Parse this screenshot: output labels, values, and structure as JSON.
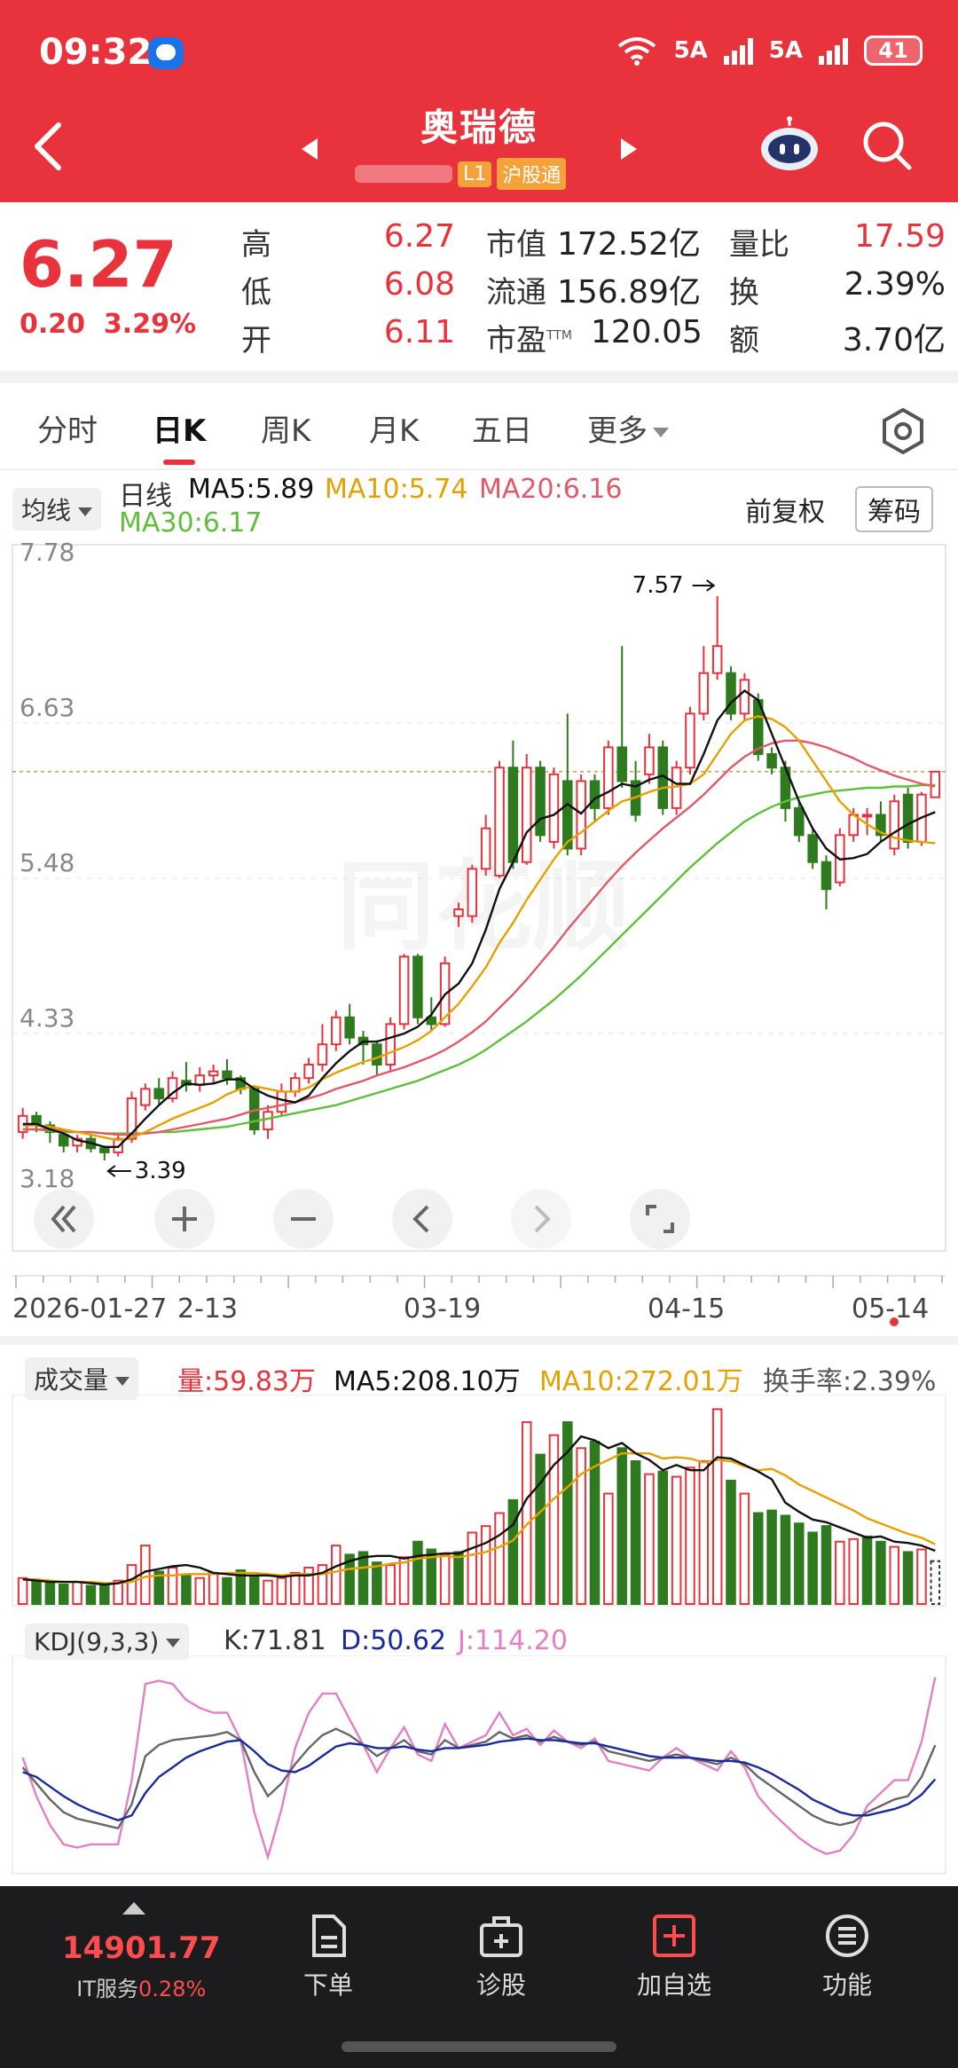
{
  "status": {
    "time": "09:32",
    "net1": "5A",
    "net2": "5A",
    "battery": "41"
  },
  "header": {
    "stock_name": "奥瑞德",
    "tag_l1": "L1",
    "tag_hgt": "沪股通"
  },
  "quote": {
    "price": "6.27",
    "change": "0.20",
    "change_pct": "3.29%",
    "high_lbl": "高",
    "high": "6.27",
    "low_lbl": "低",
    "low": "6.08",
    "open_lbl": "开",
    "open": "6.11",
    "mktcap_lbl": "市值",
    "mktcap": "172.52亿",
    "float_lbl": "流通",
    "float": "156.89亿",
    "pe_lbl": "市盈",
    "pe_sup": "TTM",
    "pe": "120.05",
    "volratio_lbl": "量比",
    "volratio": "17.59",
    "turnover_lbl": "换",
    "turnover": "2.39%",
    "amount_lbl": "额",
    "amount": "3.70亿"
  },
  "tabs": [
    "分时",
    "日K",
    "周K",
    "月K",
    "五日",
    "更多"
  ],
  "ma": {
    "dropdown": "均线",
    "period": "日线",
    "ma5": "MA5:5.89",
    "ma10": "MA10:5.74",
    "ma20": "MA20:6.16",
    "ma30": "MA30:6.17",
    "fq": "前复权",
    "chip": "筹码",
    "colors": {
      "ma5": "#111111",
      "ma10": "#e6a100",
      "ma20": "#e05a6a",
      "ma30": "#5fbf3a"
    }
  },
  "chart_data": [
    {
      "type": "candlestick",
      "title": "",
      "y_ticks": [
        "7.78",
        "6.63",
        "5.48",
        "4.33",
        "3.18"
      ],
      "ylim": [
        3.18,
        7.78
      ],
      "x_ticks": [
        "2026-01-27",
        "2-13",
        "03-19",
        "04-15",
        "05-14"
      ],
      "annotations": {
        "high": "7.57",
        "low": "3.39"
      },
      "current_price": 6.27,
      "candles": [
        [
          3.6,
          3.72,
          3.55,
          3.78
        ],
        [
          3.72,
          3.65,
          3.6,
          3.75
        ],
        [
          3.65,
          3.6,
          3.52,
          3.68
        ],
        [
          3.58,
          3.5,
          3.45,
          3.6
        ],
        [
          3.5,
          3.55,
          3.45,
          3.58
        ],
        [
          3.55,
          3.48,
          3.45,
          3.58
        ],
        [
          3.48,
          3.45,
          3.39,
          3.5
        ],
        [
          3.45,
          3.55,
          3.42,
          3.58
        ],
        [
          3.55,
          3.85,
          3.52,
          3.9
        ],
        [
          3.8,
          3.92,
          3.76,
          3.96
        ],
        [
          3.92,
          3.85,
          3.8,
          4.0
        ],
        [
          3.85,
          4.0,
          3.82,
          4.05
        ],
        [
          3.98,
          3.95,
          3.9,
          4.12
        ],
        [
          3.95,
          4.02,
          3.9,
          4.08
        ],
        [
          4.02,
          4.05,
          3.96,
          4.1
        ],
        [
          4.05,
          4.0,
          3.95,
          4.14
        ],
        [
          4.0,
          3.92,
          3.88,
          4.02
        ],
        [
          3.92,
          3.62,
          3.58,
          3.94
        ],
        [
          3.62,
          3.75,
          3.55,
          3.8
        ],
        [
          3.75,
          3.9,
          3.72,
          3.96
        ],
        [
          3.9,
          4.0,
          3.86,
          4.04
        ],
        [
          4.0,
          4.1,
          3.96,
          4.15
        ],
        [
          4.1,
          4.25,
          4.05,
          4.4
        ],
        [
          4.25,
          4.45,
          4.2,
          4.5
        ],
        [
          4.45,
          4.3,
          4.25,
          4.55
        ],
        [
          4.3,
          4.25,
          4.1,
          4.35
        ],
        [
          4.25,
          4.1,
          4.02,
          4.28
        ],
        [
          4.1,
          4.4,
          4.05,
          4.45
        ],
        [
          4.4,
          4.9,
          4.36,
          4.92
        ],
        [
          4.9,
          4.45,
          4.4,
          4.92
        ],
        [
          4.45,
          4.4,
          4.35,
          4.6
        ],
        [
          4.4,
          4.85,
          4.38,
          4.9
        ],
        [
          5.2,
          5.25,
          5.12,
          5.3
        ],
        [
          5.2,
          5.55,
          5.15,
          5.58
        ],
        [
          5.55,
          5.85,
          5.5,
          5.95
        ],
        [
          5.5,
          6.3,
          5.48,
          6.35
        ],
        [
          6.3,
          5.6,
          5.55,
          6.5
        ],
        [
          5.6,
          6.3,
          5.58,
          6.4
        ],
        [
          6.3,
          5.8,
          5.75,
          6.35
        ],
        [
          5.75,
          6.25,
          5.7,
          6.3
        ],
        [
          6.2,
          5.7,
          5.65,
          6.7
        ],
        [
          5.7,
          6.2,
          5.65,
          6.25
        ],
        [
          6.2,
          6.0,
          5.9,
          6.25
        ],
        [
          6.0,
          6.45,
          5.95,
          6.5
        ],
        [
          6.45,
          6.2,
          6.15,
          7.2
        ],
        [
          6.2,
          5.95,
          5.9,
          6.35
        ],
        [
          6.25,
          6.45,
          6.18,
          6.55
        ],
        [
          6.45,
          6.0,
          5.95,
          6.5
        ],
        [
          6.0,
          6.3,
          5.95,
          6.35
        ],
        [
          6.3,
          6.7,
          6.25,
          6.75
        ],
        [
          6.7,
          7.0,
          6.65,
          7.2
        ],
        [
          7.0,
          7.2,
          6.95,
          7.57
        ],
        [
          7.0,
          6.7,
          6.65,
          7.05
        ],
        [
          6.7,
          6.95,
          6.65,
          7.0
        ],
        [
          6.8,
          6.4,
          6.35,
          6.85
        ],
        [
          6.4,
          6.3,
          6.25,
          6.45
        ],
        [
          6.3,
          6.0,
          5.9,
          6.35
        ],
        [
          6.0,
          5.8,
          5.75,
          6.05
        ],
        [
          5.8,
          5.6,
          5.55,
          5.85
        ],
        [
          5.6,
          5.4,
          5.25,
          5.65
        ],
        [
          5.45,
          5.8,
          5.42,
          5.85
        ],
        [
          5.8,
          5.95,
          5.75,
          6.0
        ],
        [
          5.95,
          5.95,
          5.8,
          6.0
        ],
        [
          5.95,
          5.8,
          5.75,
          6.05
        ],
        [
          5.7,
          6.05,
          5.65,
          6.1
        ],
        [
          6.1,
          5.75,
          5.7,
          6.15
        ],
        [
          5.75,
          6.1,
          5.72,
          6.12
        ],
        [
          6.08,
          6.27,
          6.08,
          6.27
        ]
      ],
      "ma5": [
        3.66,
        3.66,
        3.62,
        3.59,
        3.54,
        3.52,
        3.49,
        3.49,
        3.59,
        3.7,
        3.8,
        3.89,
        3.96,
        3.95,
        3.96,
        3.99,
        3.99,
        3.92,
        3.87,
        3.84,
        3.82,
        3.87,
        4.0,
        4.11,
        4.2,
        4.27,
        4.27,
        4.3,
        4.33,
        4.38,
        4.47,
        4.62,
        4.7,
        4.85,
        5.1,
        5.4,
        5.6,
        5.82,
        5.92,
        5.95,
        6.03,
        5.96,
        6.07,
        6.12,
        6.18,
        6.16,
        6.21,
        6.24,
        6.18,
        6.18,
        6.4,
        6.65,
        6.78,
        6.87,
        6.8,
        6.55,
        6.3,
        6.05,
        5.85,
        5.7,
        5.62,
        5.63,
        5.66,
        5.75,
        5.82,
        5.88,
        5.93,
        5.97
      ],
      "ma10": [
        3.65,
        3.65,
        3.64,
        3.62,
        3.6,
        3.58,
        3.56,
        3.54,
        3.56,
        3.6,
        3.65,
        3.7,
        3.74,
        3.78,
        3.82,
        3.88,
        3.92,
        3.94,
        3.92,
        3.9,
        3.9,
        3.93,
        3.99,
        4.04,
        4.08,
        4.12,
        4.15,
        4.19,
        4.23,
        4.28,
        4.35,
        4.45,
        4.55,
        4.68,
        4.82,
        5.0,
        5.15,
        5.32,
        5.47,
        5.62,
        5.75,
        5.82,
        5.9,
        5.98,
        6.05,
        6.08,
        6.12,
        6.15,
        6.16,
        6.18,
        6.25,
        6.4,
        6.55,
        6.65,
        6.68,
        6.66,
        6.6,
        6.5,
        6.35,
        6.2,
        6.05,
        5.95,
        5.88,
        5.82,
        5.78,
        5.76,
        5.75,
        5.74
      ],
      "ma20": [
        3.62,
        3.62,
        3.62,
        3.61,
        3.6,
        3.6,
        3.59,
        3.58,
        3.58,
        3.59,
        3.6,
        3.62,
        3.64,
        3.66,
        3.68,
        3.7,
        3.73,
        3.76,
        3.78,
        3.8,
        3.82,
        3.85,
        3.88,
        3.92,
        3.95,
        3.98,
        4.02,
        4.05,
        4.08,
        4.12,
        4.16,
        4.21,
        4.27,
        4.34,
        4.42,
        4.52,
        4.62,
        4.73,
        4.85,
        4.97,
        5.1,
        5.22,
        5.34,
        5.46,
        5.57,
        5.67,
        5.76,
        5.85,
        5.93,
        6.01,
        6.1,
        6.2,
        6.3,
        6.38,
        6.44,
        6.48,
        6.5,
        6.5,
        6.48,
        6.45,
        6.41,
        6.37,
        6.32,
        6.28,
        6.24,
        6.21,
        6.18,
        6.16
      ],
      "ma30": [
        3.62,
        3.62,
        3.61,
        3.6,
        3.6,
        3.6,
        3.59,
        3.59,
        3.59,
        3.59,
        3.6,
        3.6,
        3.61,
        3.62,
        3.63,
        3.64,
        3.66,
        3.68,
        3.7,
        3.72,
        3.74,
        3.76,
        3.78,
        3.8,
        3.83,
        3.86,
        3.89,
        3.92,
        3.95,
        3.98,
        4.02,
        4.06,
        4.1,
        4.15,
        4.21,
        4.28,
        4.35,
        4.42,
        4.5,
        4.58,
        4.67,
        4.76,
        4.86,
        4.96,
        5.06,
        5.16,
        5.26,
        5.36,
        5.46,
        5.56,
        5.65,
        5.74,
        5.82,
        5.9,
        5.96,
        6.01,
        6.05,
        6.08,
        6.1,
        6.12,
        6.13,
        6.14,
        6.15,
        6.15,
        6.16,
        6.16,
        6.17,
        6.17
      ]
    },
    {
      "type": "bar",
      "title": "成交量",
      "dropdown": "成交量",
      "vol_label": "量:59.83万",
      "ma5_label": "MA5:208.10万",
      "ma10_label": "MA10:272.01万",
      "turnover_label": "换手率:2.39%",
      "values": [
        20,
        18,
        16,
        15,
        17,
        14,
        15,
        18,
        30,
        45,
        25,
        28,
        22,
        20,
        24,
        20,
        26,
        22,
        18,
        20,
        24,
        28,
        30,
        45,
        38,
        40,
        32,
        30,
        36,
        48,
        42,
        38,
        40,
        55,
        60,
        70,
        80,
        140,
        115,
        130,
        140,
        120,
        125,
        85,
        120,
        110,
        100,
        102,
        98,
        105,
        110,
        150,
        95,
        85,
        70,
        72,
        68,
        62,
        55,
        60,
        48,
        50,
        52,
        48,
        44,
        40,
        42,
        33
      ],
      "up": [
        1,
        0,
        0,
        0,
        1,
        0,
        0,
        1,
        1,
        1,
        0,
        1,
        0,
        1,
        1,
        0,
        0,
        0,
        1,
        1,
        1,
        1,
        1,
        1,
        0,
        0,
        0,
        1,
        1,
        0,
        0,
        1,
        0,
        1,
        1,
        1,
        0,
        1,
        0,
        1,
        0,
        1,
        0,
        1,
        0,
        0,
        1,
        0,
        1,
        1,
        1,
        1,
        0,
        1,
        0,
        0,
        0,
        0,
        0,
        0,
        1,
        1,
        0,
        0,
        1,
        0,
        1,
        1
      ],
      "ma5": [
        19,
        18,
        17,
        17,
        17,
        16,
        15,
        16,
        19,
        25,
        27,
        29,
        30,
        28,
        24,
        23,
        22,
        22,
        22,
        21,
        22,
        22,
        24,
        29,
        33,
        36,
        37,
        37,
        35,
        37,
        38,
        39,
        39,
        43,
        47,
        53,
        61,
        81,
        93,
        107,
        117,
        129,
        126,
        120,
        124,
        116,
        111,
        103,
        107,
        103,
        103,
        113,
        112,
        107,
        102,
        96,
        78,
        71,
        65,
        63,
        59,
        55,
        51,
        52,
        48,
        47,
        45,
        41
      ],
      "ma10": [
        19,
        19,
        18,
        17,
        17,
        17,
        16,
        16,
        17,
        21,
        22,
        22,
        23,
        23,
        23,
        24,
        24,
        24,
        23,
        22,
        23,
        23,
        23,
        25,
        27,
        28,
        29,
        31,
        32,
        35,
        36,
        37,
        36,
        38,
        40,
        44,
        49,
        61,
        71,
        81,
        90,
        100,
        106,
        111,
        116,
        116,
        116,
        112,
        113,
        112,
        109,
        111,
        110,
        106,
        103,
        104,
        99,
        92,
        87,
        82,
        77,
        72,
        66,
        62,
        58,
        54,
        51,
        46
      ]
    },
    {
      "type": "line",
      "title": "KDJ(9,3,3)",
      "dropdown": "KDJ(9,3,3)",
      "k_label": "K:71.81",
      "d_label": "D:50.62",
      "j_label": "J:114.20",
      "ylim": [
        0,
        100
      ],
      "K": [
        58,
        48,
        38,
        30,
        26,
        24,
        22,
        20,
        35,
        65,
        72,
        75,
        76,
        77,
        78,
        80,
        75,
        55,
        40,
        48,
        60,
        70,
        78,
        82,
        78,
        72,
        65,
        70,
        75,
        68,
        66,
        75,
        70,
        72,
        74,
        80,
        76,
        78,
        74,
        77,
        74,
        72,
        74,
        68,
        66,
        64,
        62,
        64,
        66,
        64,
        62,
        60,
        64,
        60,
        52,
        46,
        40,
        34,
        28,
        24,
        22,
        24,
        30,
        34,
        38,
        40,
        52,
        71.81
      ],
      "D": [
        55,
        52,
        46,
        40,
        35,
        31,
        28,
        25,
        28,
        42,
        52,
        58,
        64,
        68,
        71,
        74,
        75,
        68,
        60,
        56,
        55,
        59,
        65,
        71,
        73,
        72,
        70,
        70,
        71,
        69,
        68,
        70,
        70,
        71,
        72,
        74,
        75,
        76,
        75,
        75,
        74,
        73,
        73,
        71,
        69,
        67,
        65,
        64,
        64,
        64,
        63,
        62,
        62,
        61,
        58,
        54,
        49,
        44,
        38,
        34,
        30,
        28,
        28,
        30,
        32,
        35,
        41,
        50.62
      ],
      "J": [
        64,
        40,
        22,
        10,
        8,
        10,
        10,
        10,
        50,
        110,
        112,
        110,
        100,
        95,
        92,
        92,
        75,
        30,
        2,
        32,
        70,
        92,
        104,
        104,
        88,
        72,
        55,
        70,
        83,
        66,
        62,
        85,
        70,
        74,
        78,
        92,
        78,
        82,
        72,
        81,
        74,
        70,
        76,
        62,
        60,
        58,
        56,
        64,
        70,
        64,
        60,
        56,
        68,
        58,
        40,
        30,
        22,
        14,
        8,
        4,
        6,
        16,
        34,
        42,
        50,
        50,
        74,
        114.2
      ]
    }
  ],
  "bottom": {
    "index_value": "14901.77",
    "index_name": "IT服务",
    "index_pct": "0.28%",
    "items": [
      "下单",
      "诊股",
      "加自选",
      "功能"
    ]
  },
  "watermark": "同花顺"
}
